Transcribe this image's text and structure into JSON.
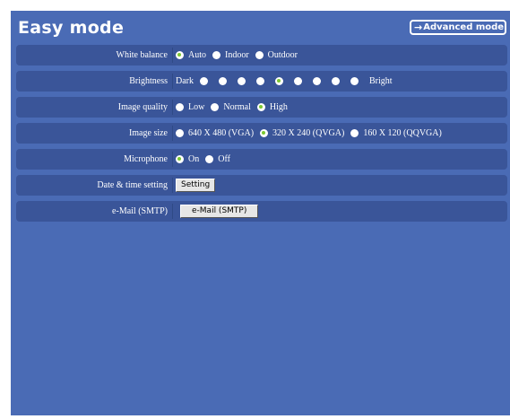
{
  "header": {
    "title": "Easy mode",
    "advanced_mode_label": "Advanced mode"
  },
  "settings": {
    "white_balance": {
      "label": "White balance",
      "options": [
        "Auto",
        "Indoor",
        "Outdoor"
      ],
      "selected": "Auto"
    },
    "brightness": {
      "label": "Brightness",
      "min_label": "Dark",
      "max_label": "Bright",
      "levels": 9,
      "selected_level": 5
    },
    "image_quality": {
      "label": "Image quality",
      "options": [
        "Low",
        "Normal",
        "High"
      ],
      "selected": "High"
    },
    "image_size": {
      "label": "Image size",
      "options": [
        "640 X 480 (VGA)",
        "320 X 240 (QVGA)",
        "160 X 120 (QQVGA)"
      ],
      "selected": "320 X 240 (QVGA)"
    },
    "microphone": {
      "label": "Microphone",
      "options": [
        "On",
        "Off"
      ],
      "selected": "On"
    },
    "date_time": {
      "label": "Date & time setting",
      "button_label": "Setting"
    },
    "email": {
      "label": "e-Mail (SMTP)",
      "button_label": "e-Mail (SMTP)"
    }
  },
  "colors": {
    "panel_bg": "#4a6bb5",
    "row_bg": "#3a5599",
    "selected_dot": "#7cc832"
  }
}
